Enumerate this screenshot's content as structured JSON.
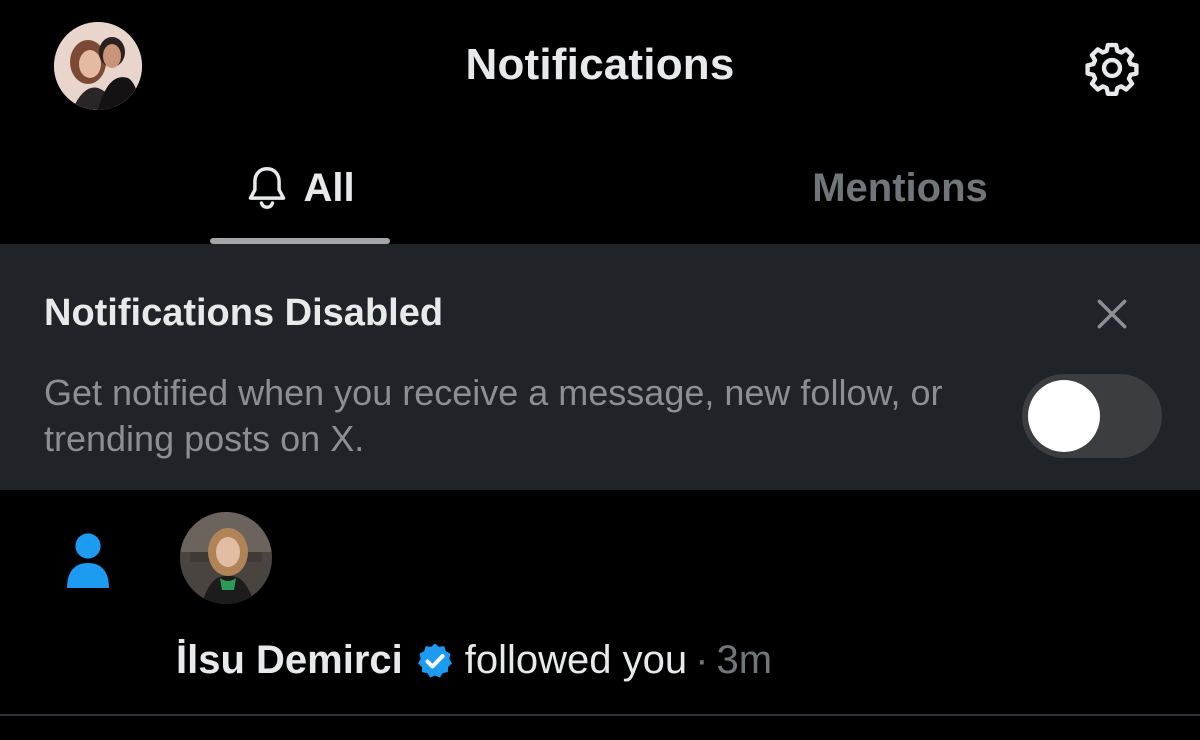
{
  "header": {
    "title": "Notifications",
    "profile_avatar": "profile-avatar",
    "settings_icon": "gear-icon"
  },
  "tabs": [
    {
      "label": "All",
      "icon": "bell-icon",
      "active": true
    },
    {
      "label": "Mentions",
      "active": false
    }
  ],
  "banner": {
    "title": "Notifications Disabled",
    "description": "Get notified when you receive a message, new follow, or trending posts on X.",
    "close_icon": "close-icon",
    "toggle_on": false
  },
  "notifications": [
    {
      "type_icon": "person-icon",
      "user_name": "İlsu Demirci",
      "verified": true,
      "action": "followed you",
      "separator": "·",
      "time": "3m"
    }
  ],
  "colors": {
    "background": "#000000",
    "banner_background": "#202327",
    "primary_text": "#e7e9ea",
    "secondary_text": "#71767b",
    "accent_blue": "#1d9bf0",
    "toggle_track": "#3b3d41"
  }
}
